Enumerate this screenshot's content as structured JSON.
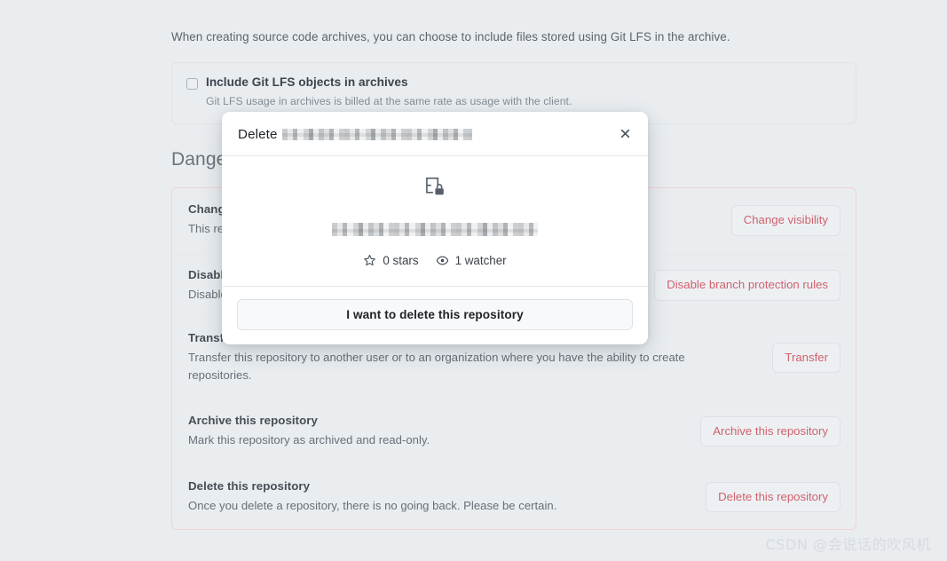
{
  "settings": {
    "lfs_intro": "When creating source code archives, you can choose to include files stored using Git LFS in the archive.",
    "lfs_checkbox_label": "Include Git LFS objects in archives",
    "lfs_checkbox_help": "Git LFS usage in archives is billed at the same rate as usage with the client.",
    "lfs_checkbox_checked": false
  },
  "danger_zone": {
    "heading": "Danger zone",
    "rows": [
      {
        "title": "Change repository visibility",
        "desc": "This repository is currently private.",
        "button": "Change visibility",
        "button_icon": "none"
      },
      {
        "title": "Disable branch protection rules",
        "desc": "Disable all branch protection rules for this repository.",
        "button": "Disable branch protection rules",
        "button_icon": "none"
      },
      {
        "title": "Transfer ownership",
        "desc": "Transfer this repository to another user or to an organization where you have the ability to create repositories.",
        "button": "Transfer",
        "button_icon": "none"
      },
      {
        "title": "Archive this repository",
        "desc": "Mark this repository as archived and read-only.",
        "button": "Archive this repository",
        "button_icon": "none"
      },
      {
        "title": "Delete this repository",
        "desc": "Once you delete a repository, there is no going back. Please be certain.",
        "button": "Delete this repository",
        "button_icon": "none"
      }
    ]
  },
  "modal": {
    "title_prefix": "Delete",
    "title_repo_redacted": true,
    "close_icon": "close-icon",
    "repo_icon": "private-repo-lock-icon",
    "repo_name_redacted": true,
    "stars_icon": "star-icon",
    "stars_text": "0 stars",
    "watchers_icon": "eye-icon",
    "watchers_text": "1 watcher",
    "confirm_button": "I want to delete this repository"
  },
  "watermark": {
    "text": "CSDN @会说话的吹风机"
  },
  "colors": {
    "page_background": "#e9edf0",
    "danger_accent": "#d0616d",
    "danger_border": "#f1d2d6",
    "modal_background": "#ffffff",
    "text_primary": "#1f2328",
    "text_secondary": "#676f77"
  }
}
